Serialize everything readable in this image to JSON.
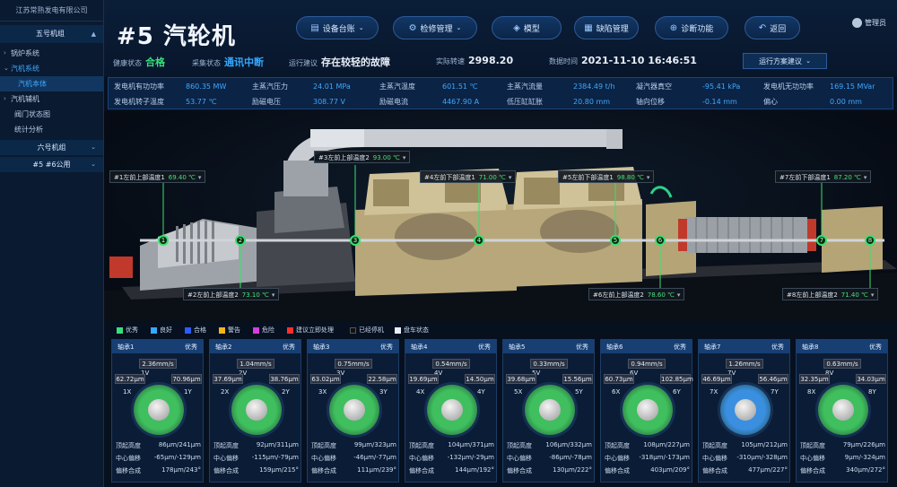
{
  "company": "江苏常熟发电有限公司",
  "sidebar": {
    "group1": "五号机组",
    "items": [
      {
        "label": "锅炉系统"
      },
      {
        "label": "汽机系统"
      },
      {
        "label": "汽机本体"
      },
      {
        "label": "汽机辅机"
      },
      {
        "label": "阀门状态图"
      },
      {
        "label": "统计分析"
      }
    ],
    "group2": "六号机组",
    "group3": "#5 #6公用"
  },
  "header": {
    "title": "#5 汽轮机",
    "buttons": {
      "ledger": "设备台账",
      "maintenance": "检修管理",
      "model": "模型",
      "defect": "缺陷管理",
      "diagnosis": "诊断功能",
      "back": "返回"
    },
    "user": "管理员",
    "status": {
      "health_label": "健康状态",
      "health_value": "合格",
      "collect_label": "采集状态",
      "collect_value": "通讯中断",
      "advice_label": "运行建议",
      "advice_value": "存在较轻的故障",
      "speed_label": "实际转速",
      "speed_value": "2998.20",
      "time_label": "数据时间",
      "time_value": "2021-11-10 16:46:51"
    },
    "advice_button": "运行方案建议"
  },
  "metrics": {
    "row1": [
      {
        "label": "发电机有功功率",
        "value": "860.35 MW"
      },
      {
        "label": "主蒸汽压力",
        "value": "24.01 MPa"
      },
      {
        "label": "主蒸汽温度",
        "value": "601.51 ℃"
      },
      {
        "label": "主蒸汽流量",
        "value": "2384.49 t/h"
      },
      {
        "label": "凝汽器真空",
        "value": "-95.41 kPa"
      },
      {
        "label": "发电机无功功率",
        "value": "169.15 MVar"
      }
    ],
    "row2": [
      {
        "label": "发电机转子温度",
        "value": "53.77 ℃"
      },
      {
        "label": "励磁电压",
        "value": "308.77 V"
      },
      {
        "label": "励磁电流",
        "value": "4467.90 A"
      },
      {
        "label": "低压缸缸胀",
        "value": "20.80 mm"
      },
      {
        "label": "轴向位移",
        "value": "-0.14 mm"
      },
      {
        "label": "偏心",
        "value": "0.00 mm"
      }
    ]
  },
  "scene_tags": [
    {
      "label": "#1左前上部温度1",
      "value": "69.40 ℃"
    },
    {
      "label": "#2左前上部温度2",
      "value": "73.10 ℃"
    },
    {
      "label": "#3左前上部温度2",
      "value": "93.00 ℃"
    },
    {
      "label": "#4左前下部温度1",
      "value": "71.00 ℃"
    },
    {
      "label": "#5左前下部温度1",
      "value": "98.80 ℃"
    },
    {
      "label": "#6左前上部温度2",
      "value": "78.60 ℃"
    },
    {
      "label": "#7左前下部温度1",
      "value": "87.20 ℃"
    },
    {
      "label": "#8左前上部温度2",
      "value": "71.40 ℃"
    }
  ],
  "bearing_numbers": [
    "1",
    "2",
    "3",
    "4",
    "5",
    "6",
    "7",
    "8"
  ],
  "legend": [
    {
      "label": "优秀",
      "color": "#37e07a"
    },
    {
      "label": "良好",
      "color": "#35a8ff"
    },
    {
      "label": "合格",
      "color": "#2c5cff"
    },
    {
      "label": "警告",
      "color": "#f2b51b"
    },
    {
      "label": "危险",
      "color": "#d53de0"
    },
    {
      "label": "建议立即处理",
      "color": "#ff2e2e"
    },
    {
      "label": "已经停机",
      "color": "#111111"
    },
    {
      "label": "盘车状态",
      "color": "#e8eef8"
    }
  ],
  "bearing_labels": {
    "peak": "顶起高度",
    "center": "中心偏移",
    "combined": "偏移合成"
  },
  "bearings": [
    {
      "name": "轴承1",
      "grade": "优秀",
      "speed": "2.36mm/s",
      "left": "62.72μm",
      "right": "70.96μm",
      "x": "1X",
      "y": "1Y",
      "v": "1V",
      "peak": "86μm/241μm",
      "center": "-65μm/-129μm",
      "combined": "178μm/243°",
      "color": "#3fbf5e"
    },
    {
      "name": "轴承2",
      "grade": "优秀",
      "speed": "1.04mm/s",
      "left": "37.69μm",
      "right": "38.76μm",
      "x": "2X",
      "y": "2Y",
      "v": "2V",
      "peak": "92μm/311μm",
      "center": "-115μm/-79μm",
      "combined": "159μm/215°",
      "color": "#3fbf5e"
    },
    {
      "name": "轴承3",
      "grade": "优秀",
      "speed": "0.75mm/s",
      "left": "63.02μm",
      "right": "22.58μm",
      "x": "3X",
      "y": "3Y",
      "v": "3V",
      "peak": "99μm/323μm",
      "center": "-46μm/-77μm",
      "combined": "111μm/239°",
      "color": "#3fbf5e"
    },
    {
      "name": "轴承4",
      "grade": "优秀",
      "speed": "0.54mm/s",
      "left": "19.69μm",
      "right": "14.50μm",
      "x": "4X",
      "y": "4Y",
      "v": "4V",
      "peak": "104μm/371μm",
      "center": "-132μm/-29μm",
      "combined": "144μm/192°",
      "color": "#3fbf5e"
    },
    {
      "name": "轴承5",
      "grade": "优秀",
      "speed": "0.33mm/s",
      "left": "39.68μm",
      "right": "15.56μm",
      "x": "5X",
      "y": "5Y",
      "v": "5V",
      "peak": "106μm/332μm",
      "center": "-86μm/-78μm",
      "combined": "130μm/222°",
      "color": "#3fbf5e"
    },
    {
      "name": "轴承6",
      "grade": "优秀",
      "speed": "0.94mm/s",
      "left": "60.73μm",
      "right": "102.85μm",
      "x": "6X",
      "y": "6Y",
      "v": "6V",
      "peak": "108μm/227μm",
      "center": "-318μm/-173μm",
      "combined": "403μm/209°",
      "color": "#3fbf5e"
    },
    {
      "name": "轴承7",
      "grade": "优秀",
      "speed": "1.26mm/s",
      "left": "46.69μm",
      "right": "56.46μm",
      "x": "7X",
      "y": "7Y",
      "v": "7V",
      "peak": "105μm/212μm",
      "center": "-310μm/-328μm",
      "combined": "477μm/227°",
      "color": "#3a8fe0"
    },
    {
      "name": "轴承8",
      "grade": "优秀",
      "speed": "0.63mm/s",
      "left": "32.35μm",
      "right": "34.03μm",
      "x": "8X",
      "y": "8Y",
      "v": "8V",
      "peak": "79μm/226μm",
      "center": "9μm/-324μm",
      "combined": "340μm/272°",
      "color": "#3fbf5e"
    }
  ]
}
